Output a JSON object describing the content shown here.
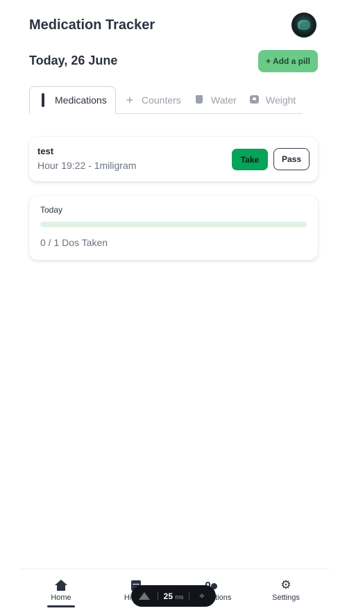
{
  "header": {
    "title": "Medication Tracker",
    "avatar_icon": "user-avatar"
  },
  "date_row": {
    "date": "Today, 26 June",
    "add_button": "+ Add a pill"
  },
  "tabs": [
    {
      "label": "Medications",
      "icon": "pill-icon",
      "active": true
    },
    {
      "label": "Counters",
      "icon": "plus-icon",
      "active": false
    },
    {
      "label": "Water",
      "icon": "glass-icon",
      "active": false
    },
    {
      "label": "Weight",
      "icon": "scale-icon",
      "active": false
    }
  ],
  "medication": {
    "name": "test",
    "detail": "Hour 19:22 - 1miligram",
    "take_label": "Take",
    "pass_label": "Pass"
  },
  "today": {
    "label": "Today",
    "progress": 0,
    "doses_text": "0 / 1 Dos Taken"
  },
  "bottom_nav": [
    {
      "label": "Home",
      "icon": "home-icon",
      "active": true
    },
    {
      "label": "History",
      "icon": "calendar-icon",
      "active": false
    },
    {
      "label": "Medications",
      "icon": "pill-icon",
      "active": false
    },
    {
      "label": "Settings",
      "icon": "gear-icon",
      "active": false
    }
  ],
  "devtools": {
    "time_value": "25",
    "time_unit": "ms"
  },
  "colors": {
    "accent_green": "#07a35a",
    "add_button_bg": "#6acb88",
    "text_dark": "#2b3240",
    "text_muted": "#6b7280"
  }
}
